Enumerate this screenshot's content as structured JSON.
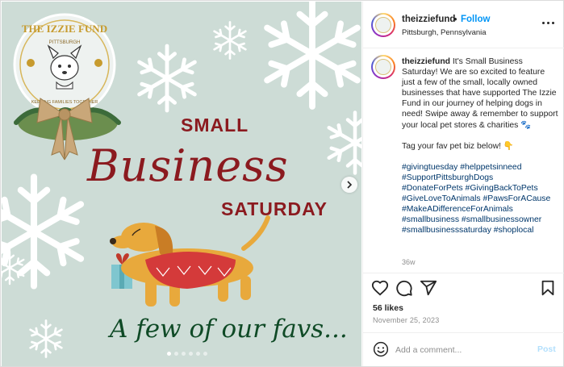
{
  "post": {
    "image": {
      "logo_text_top": "THE IZZIE FUND",
      "logo_text_city": "PITTSBURGH",
      "logo_text_bottom": "KEEPING FAMILIES TOGETHER",
      "headline_top": "SMALL",
      "headline_main": "Business",
      "headline_bottom": "SATURDAY",
      "tagline": "A few of our favs...",
      "next_icon": "chevron-right-icon",
      "carousel_slides": 6,
      "carousel_active": 0,
      "colors": {
        "background": "#cddcd6",
        "headline": "#8b1a1f",
        "tagline": "#0f4a26"
      }
    },
    "header": {
      "username": "theizziefund",
      "separator": "•",
      "follow_label": "Follow",
      "location": "Pittsburgh, Pennsylvania",
      "more_icon": "more-horizontal-icon"
    },
    "caption": {
      "username": "theizziefund",
      "text": "It's Small Business Saturday! We are so excited to feature just a few of the small, locally owned businesses that have supported The Izzie Fund in our journey of helping dogs in need! Swipe away & remember to support your local pet stores & charities 🐾",
      "line2": "Tag your fav pet biz below! 👇",
      "hashtags": [
        "#givingtuesday #helppetsinneed",
        "#SupportPittsburghDogs",
        "#DonateForPets #GivingBackToPets",
        "#GiveLoveToAnimals #PawsForACause",
        "#MakeADifferenceForAnimals",
        "#smallbusiness #smallbusinessowner",
        "#smallbusinesssaturday #shoplocal"
      ],
      "age": "36w"
    },
    "actions": {
      "like_icon": "heart-icon",
      "comment_icon": "comment-icon",
      "share_icon": "share-icon",
      "save_icon": "bookmark-icon"
    },
    "likes": "56 likes",
    "date": "November 25, 2023",
    "comment": {
      "emoji_icon": "emoji-icon",
      "placeholder": "Add a comment...",
      "post_label": "Post",
      "post_color": "#b2dffc"
    },
    "accent_color": "#0095f6"
  }
}
